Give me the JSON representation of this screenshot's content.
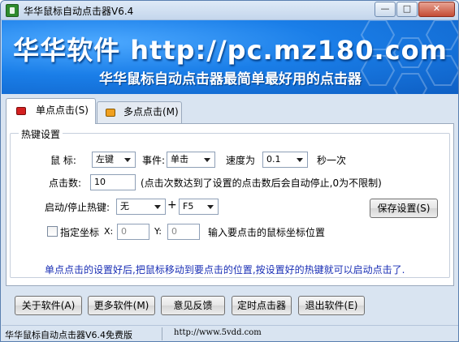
{
  "window": {
    "title": "华华鼠标自动点击器V6.4",
    "controls": {
      "minimize": "—",
      "maximize": "□",
      "close": "✕"
    }
  },
  "banner": {
    "title": "华华软件 http://pc.mz180.com",
    "subtitle": "华华鼠标自动点击器最简单最好用的点击器"
  },
  "tabs": [
    {
      "label": "单点点击(S)"
    },
    {
      "label": "多点点击(M)"
    }
  ],
  "hotkey_group": {
    "title": "热键设置",
    "mouse_label": "鼠 标:",
    "mouse_value": "左键",
    "event_label": "事件:",
    "event_value": "单击",
    "speed_label": "速度为",
    "speed_value": "0.1",
    "speed_unit": "秒一次",
    "count_label": "点击数:",
    "count_value": "10",
    "count_note": "(点击次数达到了设置的点击数后会自动停止,0为不限制)",
    "hotkey_label": "启动/停止热键:",
    "modifier_value": "无",
    "plus": "+",
    "key_value": "F5",
    "save_button": "保存设置(S)",
    "fixed_coord_label": "指定坐标",
    "x_label": "X:",
    "x_value": "0",
    "y_label": "Y:",
    "y_value": "0",
    "coord_hint": "输入要点击的鼠标坐标位置",
    "instructions": "单点点击的设置好后,把鼠标移动到要点击的位置,按设置好的热键就可以启动点击了."
  },
  "bottom_buttons": {
    "about": "关于软件(A)",
    "more": "更多软件(M)",
    "feedback": "意见反馈",
    "timer": "定时点击器",
    "exit": "退出软件(E)"
  },
  "statusbar": {
    "left": "华华鼠标自动点击器V6.4免费版",
    "right": "http://www.5vdd.com"
  },
  "colors": {
    "banner_blue": "#1a7ee8",
    "hint_blue": "#1a2fb5",
    "tab_single_icon": "#d42020",
    "tab_multi_icon": "#f0a020"
  }
}
